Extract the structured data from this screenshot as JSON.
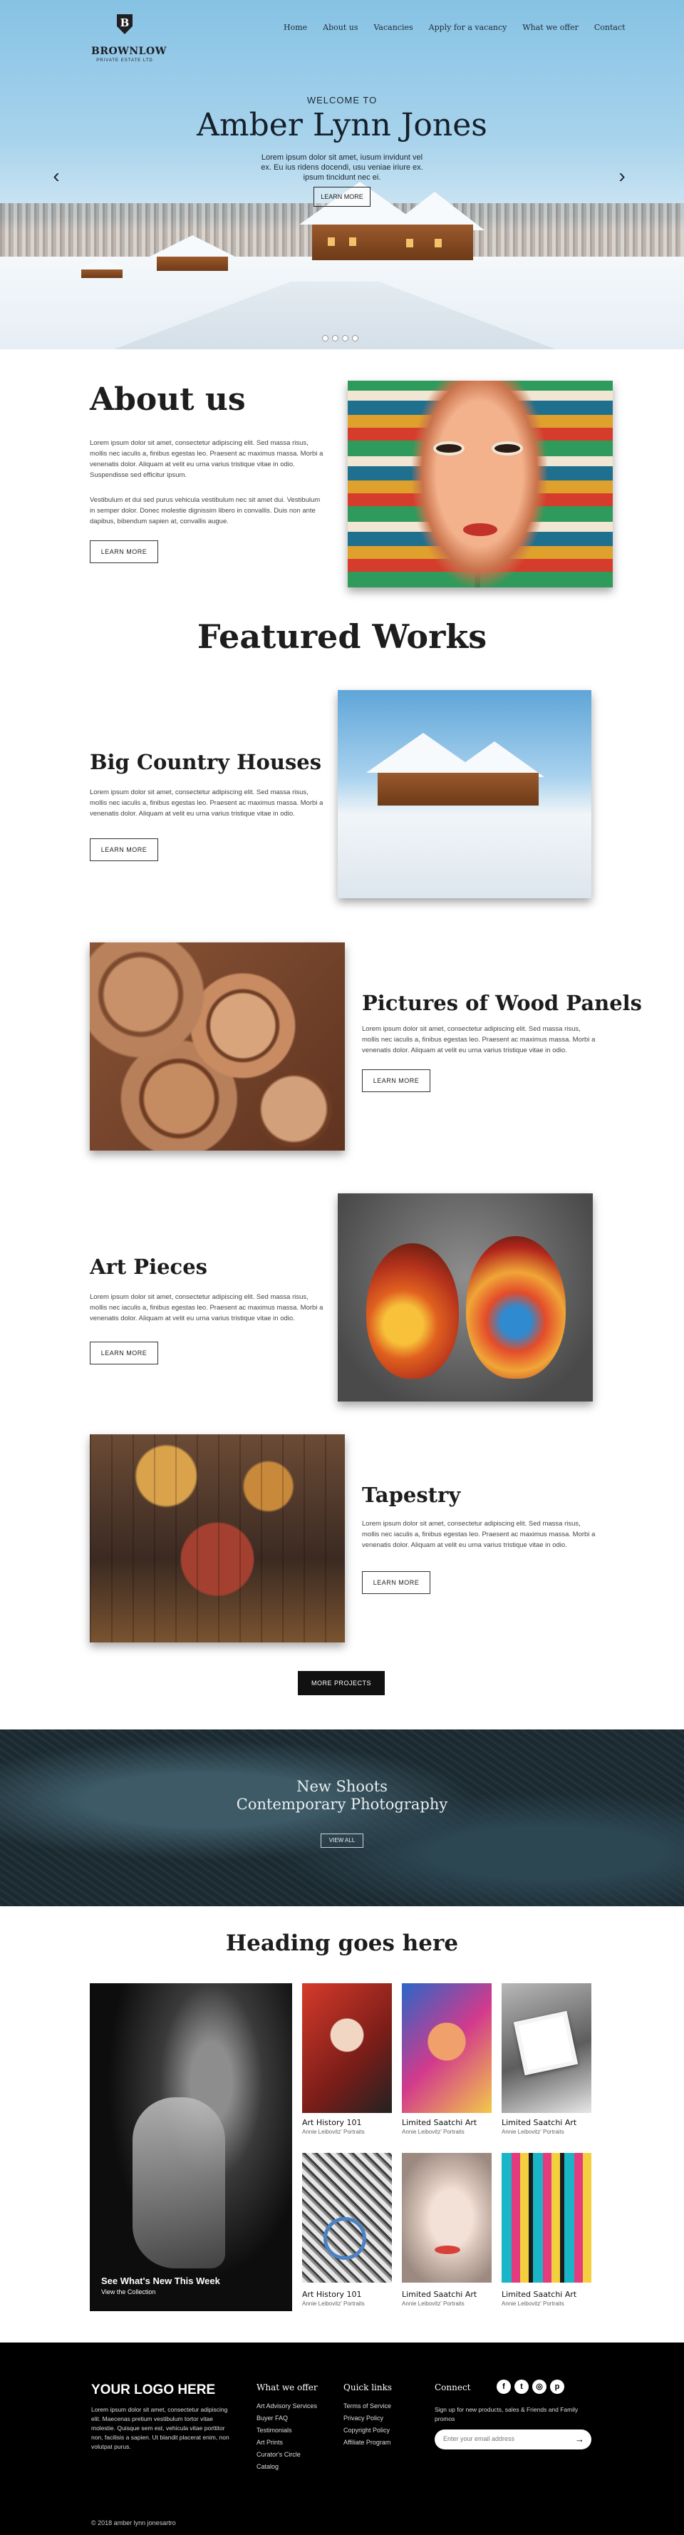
{
  "brand": {
    "name": "BROWNLOW",
    "tagline": "PRIVATE ESTATE LTD",
    "crest_letter": "B"
  },
  "nav": [
    "Home",
    "About us",
    "Vacancies",
    "Apply for a vacancy",
    "What we offer",
    "Contact"
  ],
  "hero": {
    "kicker": "WELCOME TO",
    "title": "Amber Lynn Jones",
    "text": "Lorem ipsum dolor sit amet, iusum invidunt vel ex. Eu ius ridens docendi, usu veniae iriure ex. ipsum tincidunt nec ei.",
    "button": "LEARN MORE",
    "prev_icon": "chevron-left-icon",
    "next_icon": "chevron-right-icon",
    "slides": 4
  },
  "about": {
    "title": "About us",
    "para1": "Lorem ipsum dolor sit amet, consectetur adipiscing elit. Sed massa risus, mollis nec iaculis a, finibus egestas leo. Praesent ac maximus massa. Morbi a venenatis dolor. Aliquam at velit eu urna varius tristique vitae in odio. Suspendisse sed efficitur ipsum.",
    "para2": "Vestibulum et dui sed purus vehicula vestibulum nec sit amet dui. Vestibulum in semper dolor. Donec molestie dignissim libero in convallis. Duis non ante dapibus, bibendum sapien at, convallis augue.",
    "button": "LEARN MORE"
  },
  "featured": {
    "title": "Featured Works",
    "body": "Lorem ipsum dolor sit amet, consectetur adipiscing elit. Sed massa risus, mollis nec iaculis a, finibus egestas leo. Praesent ac maximus massa. Morbi a venenatis dolor. Aliquam at velit eu urna varius tristique vitae in odio.",
    "items": [
      {
        "title": "Big Country Houses",
        "button": "LEARN MORE"
      },
      {
        "title": "Pictures of Wood Panels",
        "button": "LEARN MORE"
      },
      {
        "title": "Art Pieces",
        "button": "LEARN MORE"
      },
      {
        "title": "Tapestry",
        "button": "LEARN MORE"
      }
    ],
    "more_button": "MORE PROJECTS"
  },
  "banner": {
    "line1": "New Shoots",
    "line2": "Contemporary Photography",
    "button": "VIEW ALL"
  },
  "gallery": {
    "title": "Heading goes here",
    "feature": {
      "title": "See What's New This Week",
      "subtitle": "View the Collection"
    },
    "tiles": [
      {
        "title": "Art History 101",
        "sub": "Annie Leibovitz' Portraits"
      },
      {
        "title": "Limited Saatchi Art",
        "sub": "Annie Leibovitz' Portraits"
      },
      {
        "title": "Limited Saatchi Art",
        "sub": "Annie Leibovitz' Portraits"
      },
      {
        "title": "Art History 101",
        "sub": "Annie Leibovitz' Portraits"
      },
      {
        "title": "Limited Saatchi Art",
        "sub": "Annie Leibovitz' Portraits"
      },
      {
        "title": "Limited Saatchi Art",
        "sub": "Annie Leibovitz' Portraits"
      }
    ]
  },
  "footer": {
    "logo": "YOUR LOGO HERE",
    "about": "Lorem ipsum dolor sit amet, consectetur adipiscing elit. Maecenas pretium vestibulum tortor vitae molestie. Quisque sem est, vehicula vitae porttitor non, facilisis a sapien. Ut blandit placerat enim, non volutpat purus.",
    "what_we_offer": {
      "title": "What we offer",
      "links": [
        "Art Advisory Services",
        "Buyer FAQ",
        "Testimonials",
        "Art Prints",
        "Curator's Circle",
        "Catalog"
      ]
    },
    "quick_links": {
      "title": "Quick links",
      "links": [
        "Terms of Service",
        "Privacy Policy",
        "Copyright Policy",
        "Affiliate Program"
      ]
    },
    "connect": {
      "title": "Connect",
      "text": "Sign up for new products, sales & Friends and Family promos",
      "placeholder": "Enter your email address",
      "socials": [
        "f",
        "t",
        "◎",
        "p"
      ]
    },
    "copyright": "© 2018 amber lynn jonesartro"
  },
  "colors": {
    "hero_sky": "#86c2e4",
    "footer_bg": "#000000",
    "banner_bg": "#1b2a31"
  }
}
